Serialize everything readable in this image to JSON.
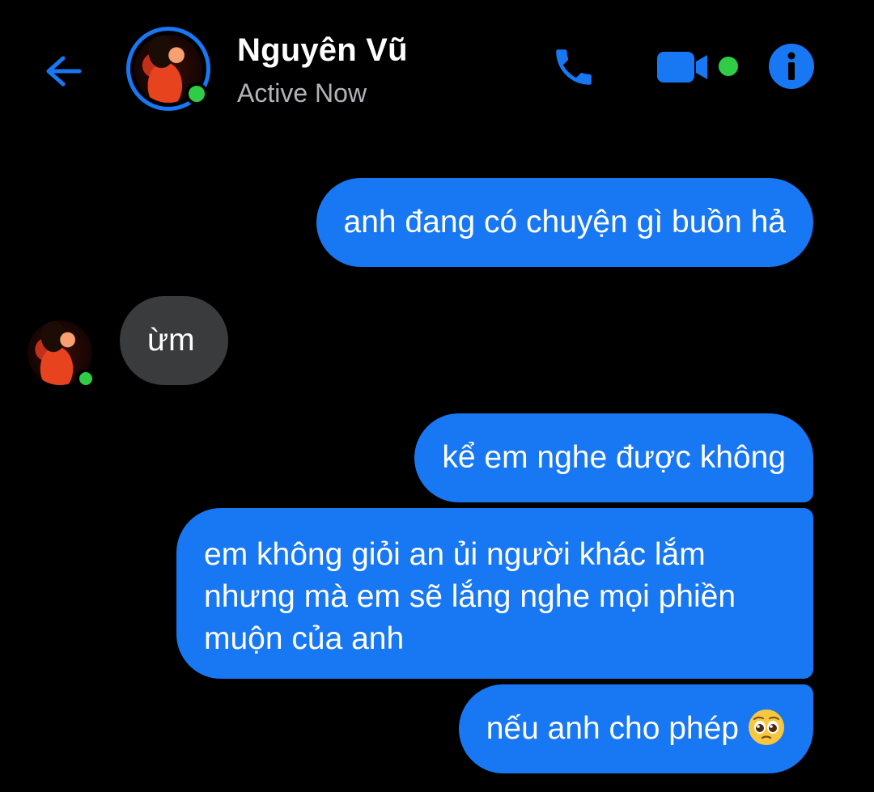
{
  "header": {
    "contact_name": "Nguyên Vũ",
    "status": "Active Now",
    "icons": [
      "back-arrow-icon",
      "phone-icon",
      "video-camera-icon",
      "info-icon"
    ],
    "accent_color": "#1877F2",
    "online_color": "#31CC46"
  },
  "messages": [
    {
      "direction": "outgoing",
      "text": "anh đang có chuyện gì buồn hả"
    },
    {
      "direction": "incoming",
      "text": "ừm"
    },
    {
      "direction": "outgoing",
      "text": "kể em nghe được không"
    },
    {
      "direction": "outgoing",
      "text": "em không giỏi an ủi người khác lắm nhưng mà em sẽ lắng nghe mọi phiền muộn của anh"
    },
    {
      "direction": "outgoing",
      "text": "nếu anh cho phép",
      "emoji": "pleading-face"
    }
  ],
  "colors": {
    "outgoing_bubble": "#1877F2",
    "incoming_bubble": "#3A3B3C",
    "background": "#000000"
  }
}
